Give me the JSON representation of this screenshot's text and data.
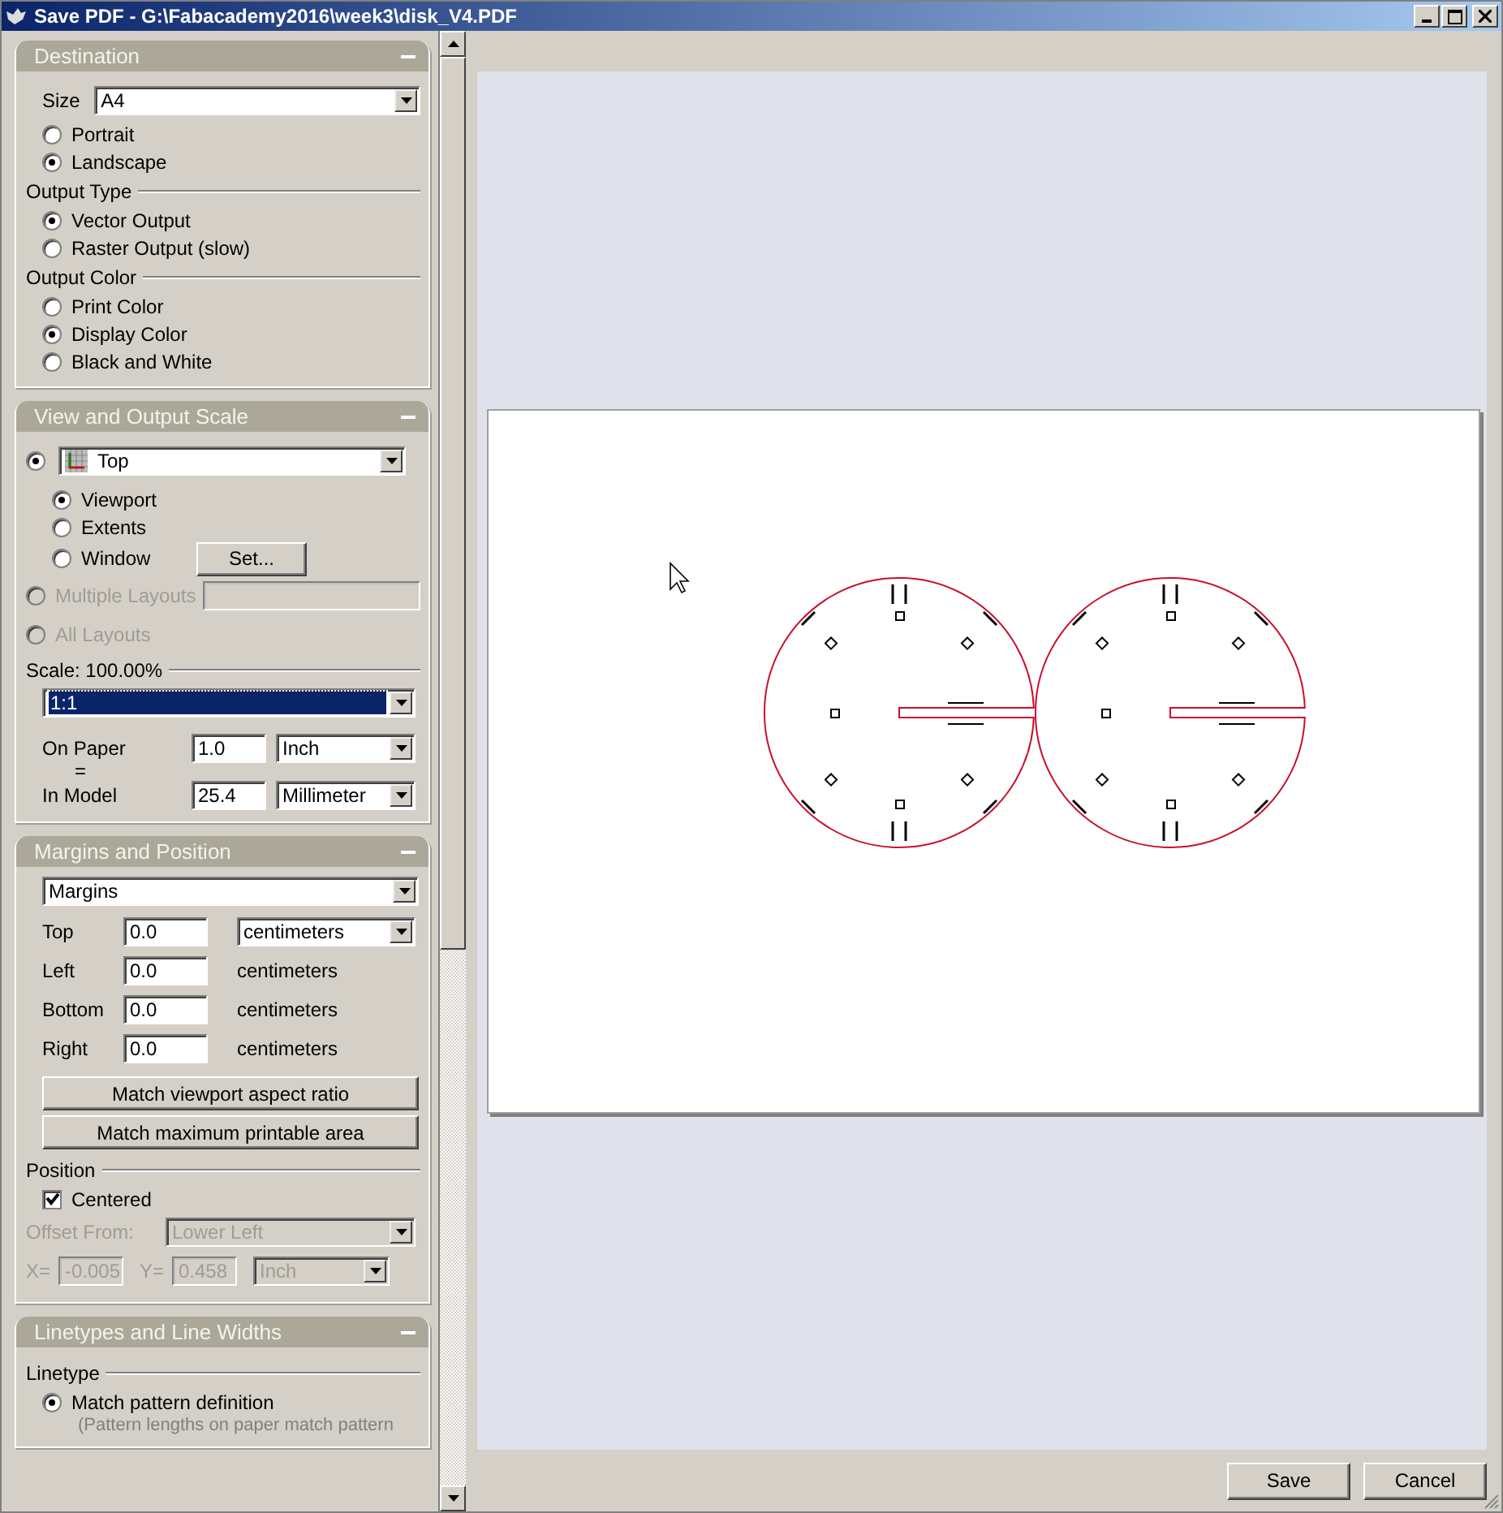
{
  "window": {
    "title": "Save PDF - G:\\Fabacademy2016\\week3\\disk_V4.PDF"
  },
  "destination": {
    "title": "Destination",
    "size": {
      "label": "Size",
      "value": "A4"
    },
    "orientation": [
      {
        "label": "Portrait",
        "selected": false
      },
      {
        "label": "Landscape",
        "selected": true
      }
    ],
    "output_type": {
      "heading": "Output Type",
      "options": [
        {
          "label": "Vector Output",
          "selected": true
        },
        {
          "label": "Raster Output (slow)",
          "selected": false
        }
      ]
    },
    "output_color": {
      "heading": "Output Color",
      "options": [
        {
          "label": "Print Color",
          "selected": false
        },
        {
          "label": "Display Color",
          "selected": true
        },
        {
          "label": "Black and White",
          "selected": false
        }
      ]
    }
  },
  "view_and_output_scale": {
    "title": "View and Output Scale",
    "view": {
      "selected": true,
      "value": "Top"
    },
    "extent": [
      {
        "label": "Viewport",
        "selected": true
      },
      {
        "label": "Extents",
        "selected": false
      },
      {
        "label": "Window",
        "selected": false
      }
    ],
    "set_button": "Set...",
    "layouts": [
      {
        "label": "Multiple Layouts",
        "selected": false,
        "disabled": true,
        "kind": "with_field"
      },
      {
        "label": "All Layouts",
        "selected": false,
        "disabled": true,
        "kind": "plain"
      }
    ],
    "scale_heading": "Scale:  100.00%",
    "scale_value": "1:1",
    "on_paper": {
      "label": "On Paper",
      "value": "1.0",
      "unit": "Inch"
    },
    "equals": "=",
    "in_model": {
      "label": "In Model",
      "value": "25.4",
      "unit": "Millimeter"
    }
  },
  "margins_and_position": {
    "title": "Margins and Position",
    "mode": "Margins",
    "rows": [
      {
        "label": "Top",
        "value": "0.0",
        "unit": "centimeters",
        "kind": "dropdown"
      },
      {
        "label": "Left",
        "value": "0.0",
        "unit": "centimeters",
        "kind": "text"
      },
      {
        "label": "Bottom",
        "value": "0.0",
        "unit": "centimeters",
        "kind": "text"
      },
      {
        "label": "Right",
        "value": "0.0",
        "unit": "centimeters",
        "kind": "text"
      }
    ],
    "buttons": [
      "Match viewport aspect ratio",
      "Match maximum printable area"
    ],
    "position_heading": "Position",
    "centered": {
      "label": "Centered",
      "checked": true
    },
    "offset": {
      "disabled": true,
      "from_label": "Offset From:",
      "from_value": "Lower Left",
      "x_label": "X=",
      "x_value": "-0.005",
      "y_label": "Y=",
      "y_value": "0.458",
      "unit": "Inch"
    }
  },
  "linetypes_and_line_widths": {
    "title": "Linetypes and Line Widths",
    "heading": "Linetype",
    "options": [
      {
        "label": "Match pattern definition",
        "selected": true,
        "note": "(Pattern lengths on paper match pattern"
      }
    ]
  },
  "buttons": [
    "Save",
    "Cancel"
  ]
}
